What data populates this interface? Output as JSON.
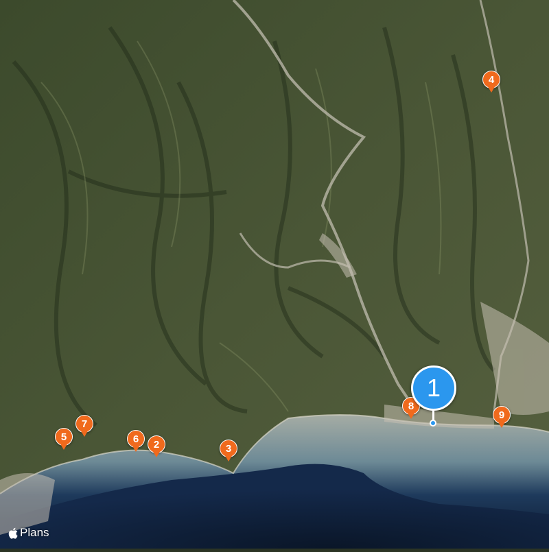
{
  "map": {
    "style": "satellite",
    "attribution": {
      "logo_icon": "apple-logo-icon",
      "text": "Plans"
    },
    "colors": {
      "pin_orange": "#f06a1d",
      "pin_selected_blue": "#2b97ee",
      "sea_deep": "#0f1f38",
      "sea_shallow": "#9aa39e"
    }
  },
  "pins": {
    "selected": {
      "label": "1"
    },
    "p2": {
      "label": "2"
    },
    "p3": {
      "label": "3"
    },
    "p4": {
      "label": "4"
    },
    "p5": {
      "label": "5"
    },
    "p6": {
      "label": "6"
    },
    "p7": {
      "label": "7"
    },
    "p8": {
      "label": "8"
    },
    "p9": {
      "label": "9"
    }
  }
}
